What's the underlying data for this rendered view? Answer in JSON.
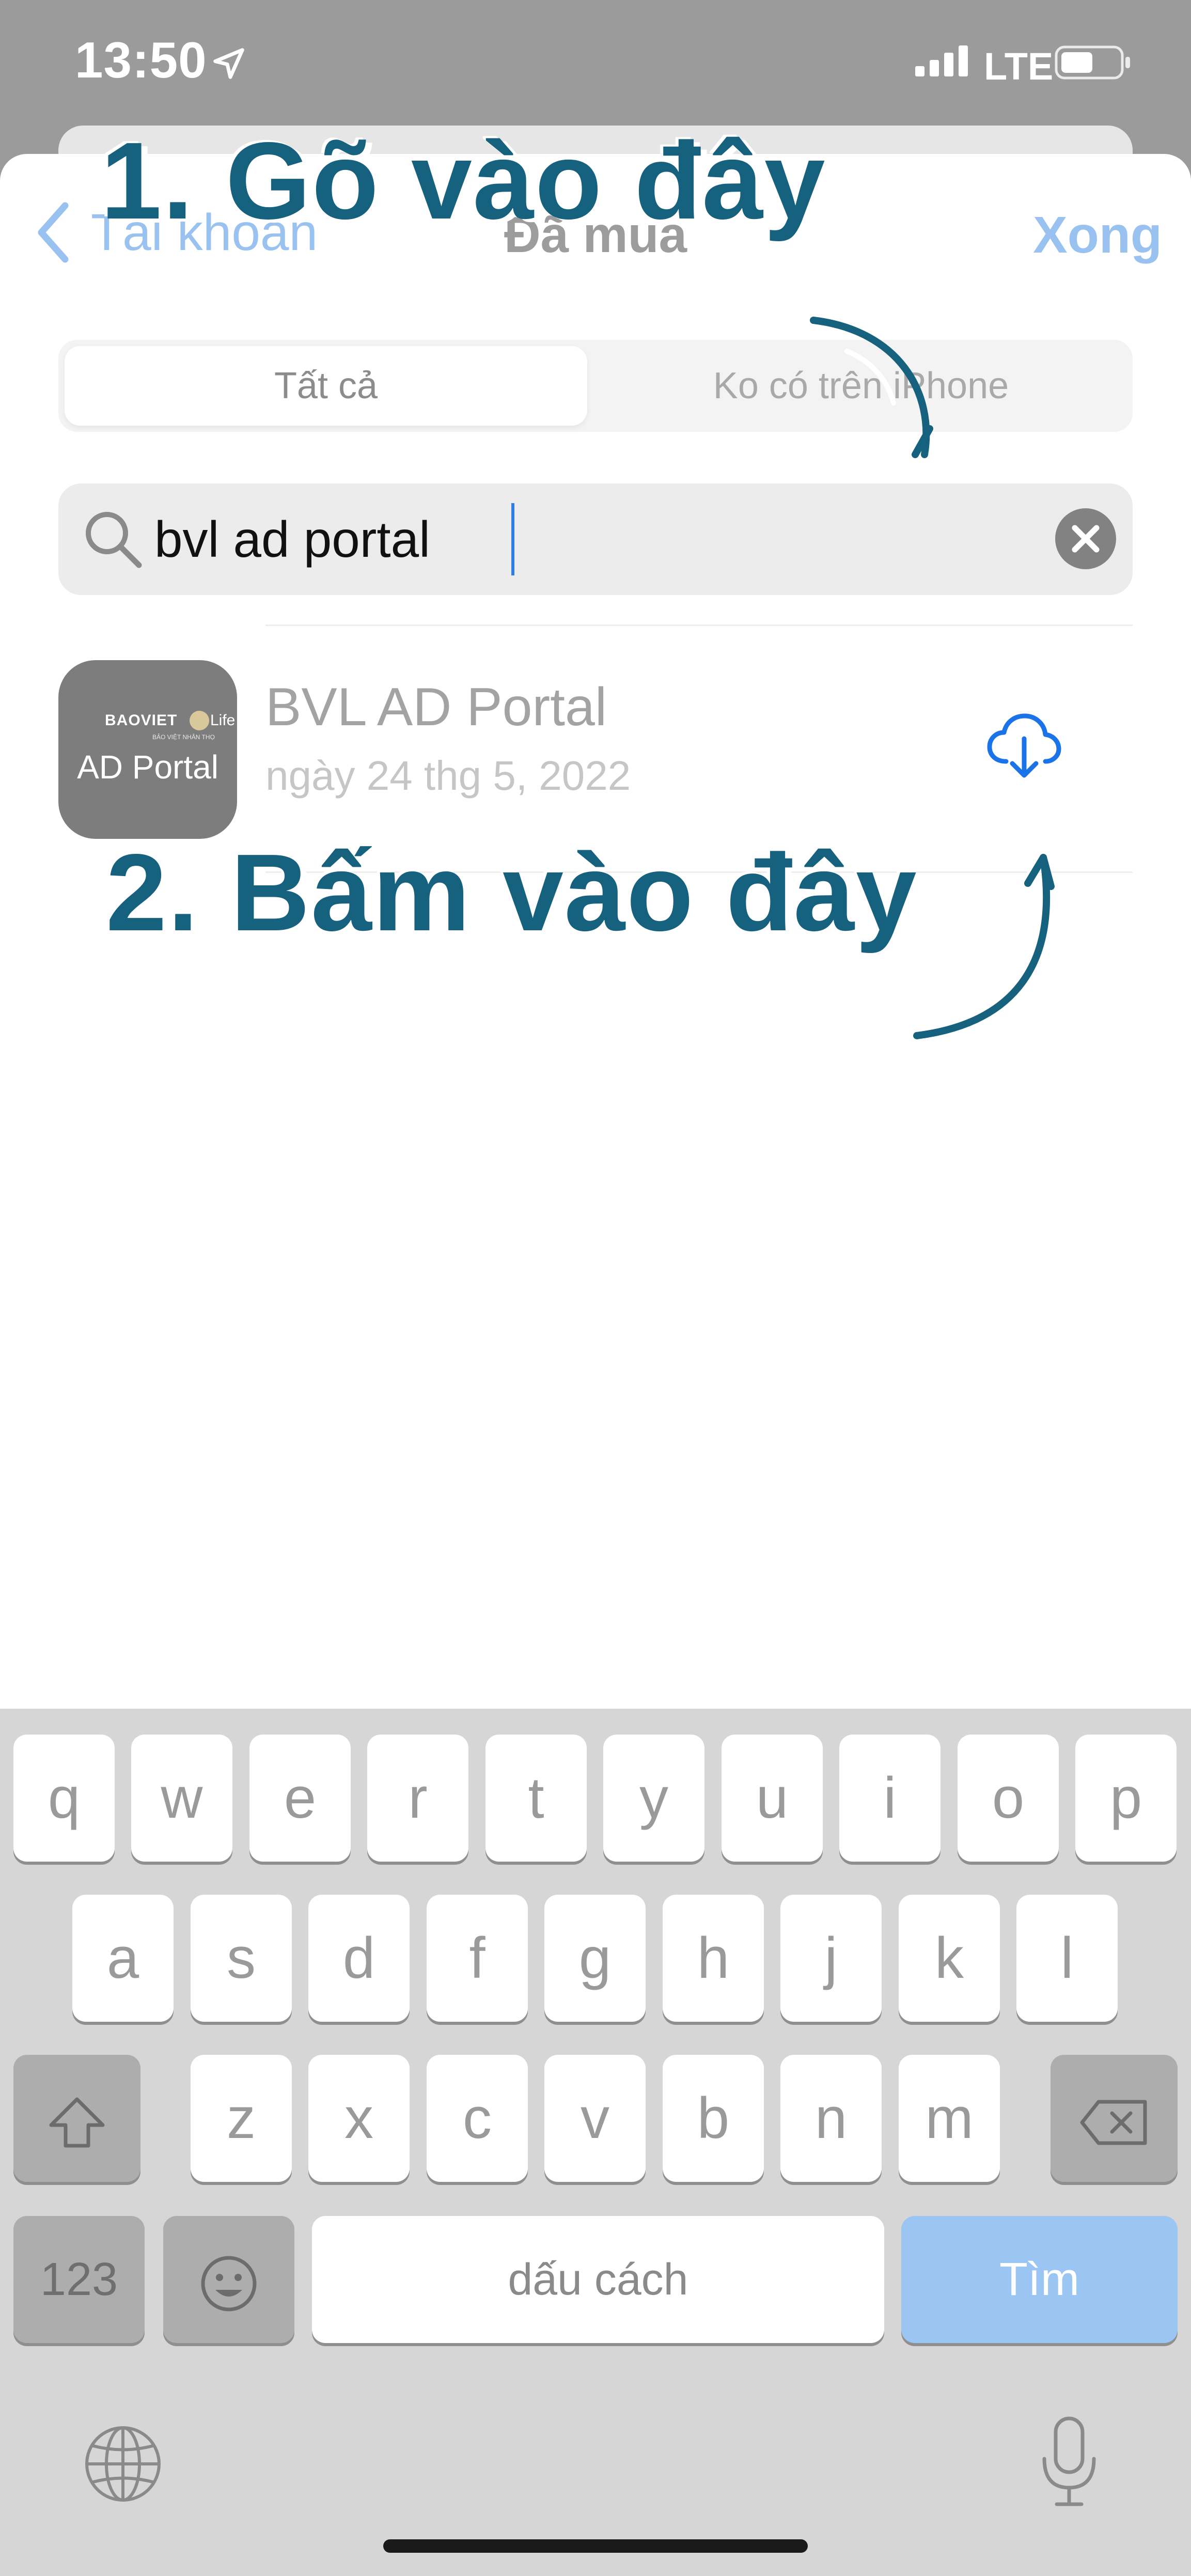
{
  "status_bar": {
    "time": "13:50",
    "network": "LTE"
  },
  "nav": {
    "back_label": "Tài khoản",
    "title": "Đã mua",
    "done_label": "Xong"
  },
  "segments": [
    "Tất cả",
    "Ko có trên iPhone"
  ],
  "search": {
    "value": "bvl ad portal"
  },
  "app": {
    "icon_brand": "BAOVIET",
    "icon_brand_suffix": "Life",
    "icon_subtitle": "BẢO VIỆT NHÂN THỌ",
    "icon_label": "AD Portal",
    "name": "BVL AD Portal",
    "date": "ngày 24 thg 5, 2022"
  },
  "annotations": {
    "step1": "1. Gõ vào đây",
    "step2": "2. Bấm vào đây"
  },
  "keyboard": {
    "row1": [
      "q",
      "w",
      "e",
      "r",
      "t",
      "y",
      "u",
      "i",
      "o",
      "p"
    ],
    "row2": [
      "a",
      "s",
      "d",
      "f",
      "g",
      "h",
      "j",
      "k",
      "l"
    ],
    "row3": [
      "z",
      "x",
      "c",
      "v",
      "b",
      "n",
      "m"
    ],
    "numbers_label": "123",
    "space_label": "dấu cách",
    "search_label": "Tìm"
  },
  "colors": {
    "accent": "#1a73e8",
    "annotation": "#15617e"
  }
}
